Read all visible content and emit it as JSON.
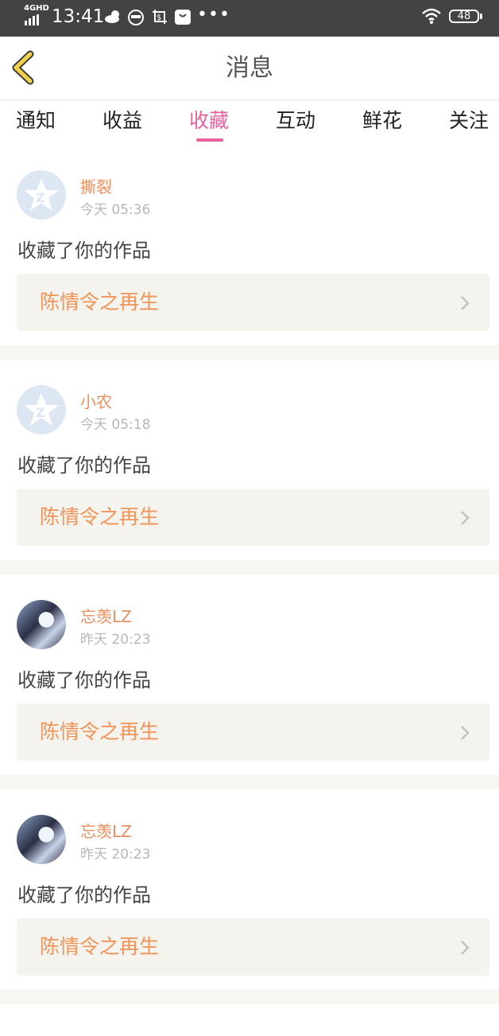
{
  "status_bar": {
    "network": "4GHD",
    "time": "13:41",
    "battery": "48"
  },
  "header": {
    "title": "消息"
  },
  "tabs": [
    {
      "label": "通知",
      "active": false
    },
    {
      "label": "收益",
      "active": false
    },
    {
      "label": "收藏",
      "active": true
    },
    {
      "label": "互动",
      "active": false
    },
    {
      "label": "鲜花",
      "active": false
    },
    {
      "label": "关注",
      "active": false
    }
  ],
  "accent_color": "#e8639e",
  "notifications": [
    {
      "user": "撕裂",
      "time": "今天 05:36",
      "action": "收藏了你的作品",
      "work": "陈情令之再生",
      "avatar": "default-avatar-icon"
    },
    {
      "user": "小农",
      "time": "今天 05:18",
      "action": "收藏了你的作品",
      "work": "陈情令之再生",
      "avatar": "default-avatar-icon"
    },
    {
      "user": "忘羡LZ",
      "time": "昨天 20:23",
      "action": "收藏了你的作品",
      "work": "陈情令之再生",
      "avatar": "photo-avatar"
    },
    {
      "user": "忘羡LZ",
      "time": "昨天 20:23",
      "action": "收藏了你的作品",
      "work": "陈情令之再生",
      "avatar": "photo-avatar"
    }
  ]
}
